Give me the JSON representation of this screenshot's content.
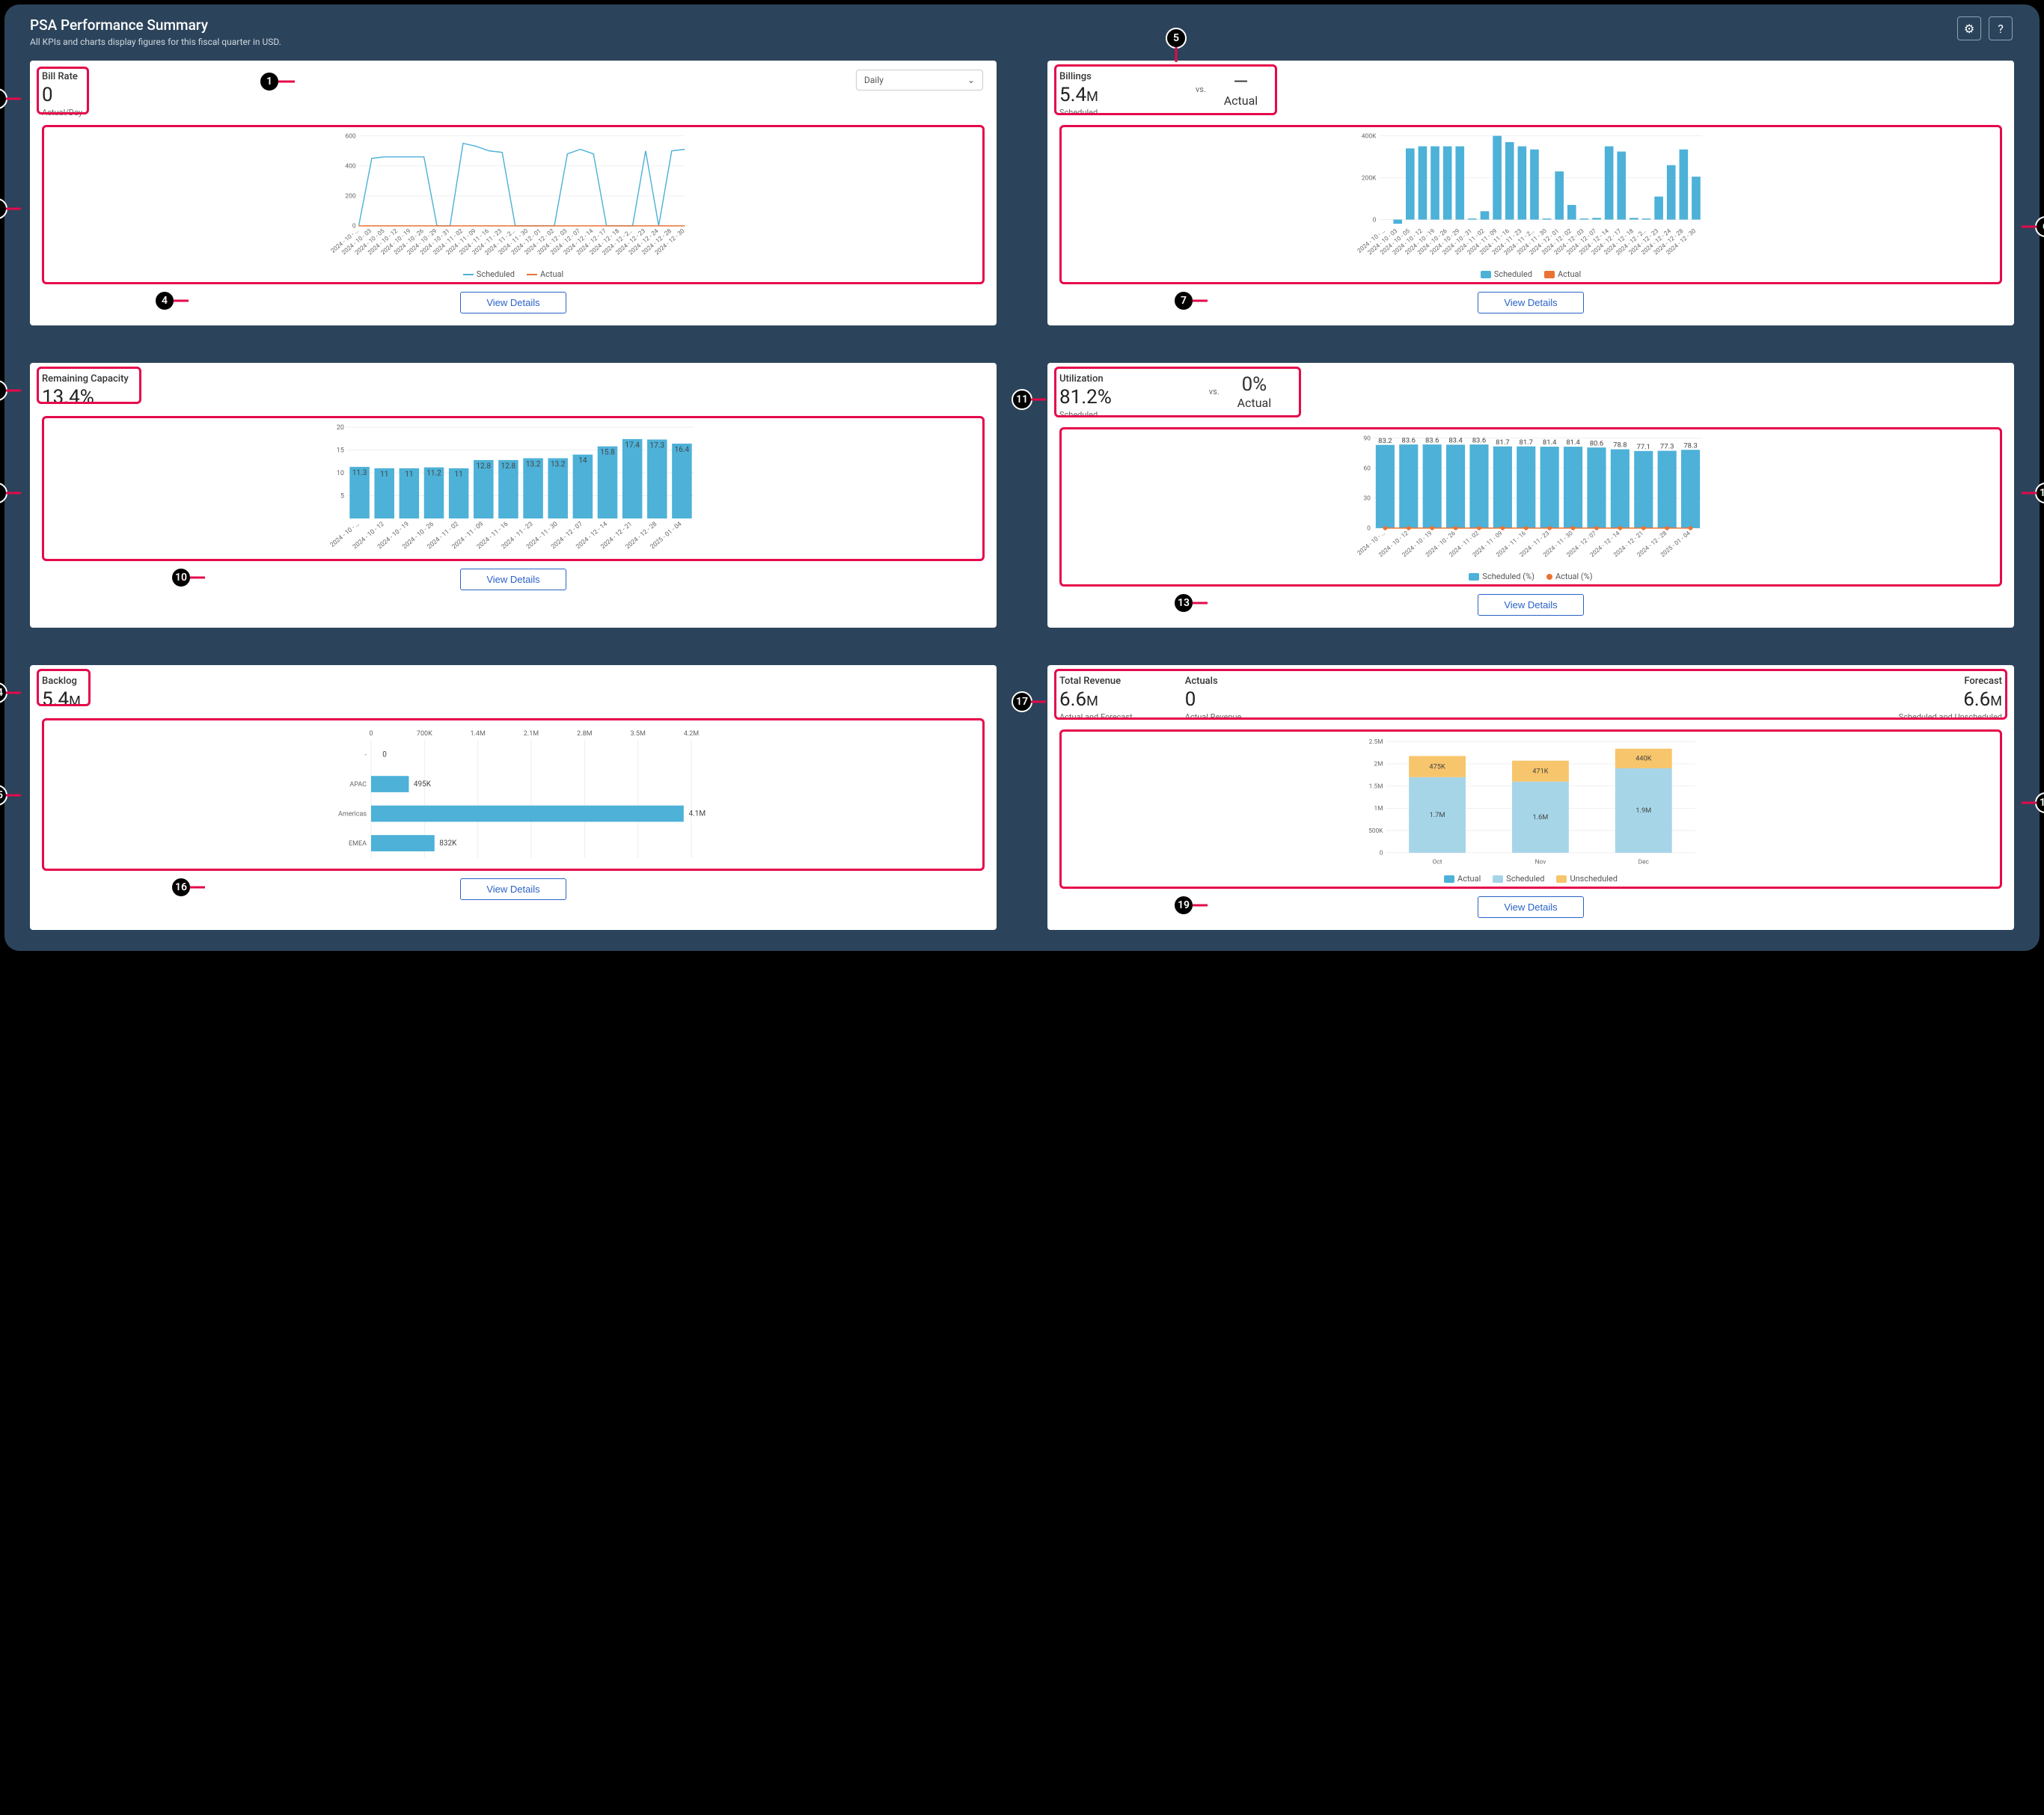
{
  "header": {
    "title": "PSA Performance Summary",
    "subtitle": "All KPIs and charts display figures for this fiscal quarter in USD."
  },
  "colors": {
    "scheduled": "#4db1d8",
    "actual": "#e97333",
    "unscheduled": "#f7c56b",
    "actualDot": "#e97333",
    "scheduledBar": "#4db1d8"
  },
  "viewDetailsLabel": "View Details",
  "cards": {
    "billRate": {
      "title": "Bill Rate",
      "value": "0",
      "sub": "Actual/Day",
      "selectLabel": "Daily",
      "legend": [
        "Scheduled",
        "Actual"
      ]
    },
    "billings": {
      "title": "Billings",
      "value": "5.4",
      "valueSuffix": "M",
      "sub": "Scheduled",
      "vsLabel": "vs.",
      "vsValue": "—",
      "vsSub": "Actual",
      "legend": [
        "Scheduled",
        "Actual"
      ]
    },
    "remaining": {
      "title": "Remaining Capacity",
      "value": "13.4%"
    },
    "utilization": {
      "title": "Utilization",
      "value": "81.2%",
      "sub": "Scheduled",
      "vsLabel": "vs.",
      "vsValue": "0%",
      "vsSub": "Actual",
      "legend": [
        "Scheduled (%)",
        "Actual (%)"
      ]
    },
    "backlog": {
      "title": "Backlog",
      "value": "5.4",
      "valueSuffix": "M"
    },
    "revenue": {
      "title": "Total Revenue",
      "value": "6.6",
      "valueSuffix": "M",
      "sub": "Actual and Forecast",
      "col2Title": "Actuals",
      "actualsValue": "0",
      "actualsSub": "Actual Revenue",
      "col3Title": "Forecast",
      "forecastValue": "6.6",
      "forecastSuffix": "M",
      "forecastSub": "Scheduled and Unscheduled",
      "legend": [
        "Actual",
        "Scheduled",
        "Unscheduled"
      ]
    }
  },
  "chart_data": [
    {
      "id": "bill_rate_chart",
      "type": "line",
      "categories": [
        "2024 - 10 - …",
        "2024 - 10 - 03",
        "2024 - 10 - 05",
        "2024 - 10 - 12",
        "2024 - 10 - 19",
        "2024 - 10 - 26",
        "2024 - 10 - 29",
        "2024 - 10 - 31",
        "2024 - 11 - 02",
        "2024 - 11 - 09",
        "2024 - 11 - 16",
        "2024 - 11 - 23",
        "2024 - 11 - 2…",
        "2024 - 11 - 30",
        "2024 - 12 - 01",
        "2024 - 12 - 02",
        "2024 - 12 - 03",
        "2024 - 12 - 07",
        "2024 - 12 - 14",
        "2024 - 12 - 17",
        "2024 - 12 - 18",
        "2024 - 12 - 2…",
        "2024 - 12 - 23",
        "2024 - 12 - 24",
        "2024 - 12 - 28",
        "2024 - 12 - 30"
      ],
      "series": [
        {
          "name": "Scheduled",
          "values": [
            0,
            450,
            460,
            460,
            460,
            460,
            0,
            0,
            550,
            530,
            500,
            490,
            0,
            0,
            0,
            0,
            480,
            510,
            480,
            0,
            0,
            0,
            500,
            0,
            500,
            510
          ]
        },
        {
          "name": "Actual",
          "values": [
            0,
            0,
            0,
            0,
            0,
            0,
            0,
            0,
            0,
            0,
            0,
            0,
            0,
            0,
            0,
            0,
            0,
            0,
            0,
            0,
            0,
            0,
            0,
            0,
            0,
            0
          ]
        }
      ],
      "ylim": [
        0,
        600
      ],
      "yticks": [
        0,
        200,
        400,
        600
      ],
      "xlabel": "",
      "ylabel": ""
    },
    {
      "id": "billings_chart",
      "type": "bar",
      "categories": [
        "2024 - 10 - …",
        "2024 - 10 - 03",
        "2024 - 10 - 05",
        "2024 - 10 - 12",
        "2024 - 10 - 19",
        "2024 - 10 - 26",
        "2024 - 10 - 29",
        "2024 - 10 - 31",
        "2024 - 11 - 02",
        "2024 - 11 - 09",
        "2024 - 11 - 16",
        "2024 - 11 - 23",
        "2024 - 11 - 2…",
        "2024 - 11 - 30",
        "2024 - 12 - 01",
        "2024 - 12 - 02",
        "2024 - 12 - 03",
        "2024 - 12 - 07",
        "2024 - 12 - 14",
        "2024 - 12 - 17",
        "2024 - 12 - 18",
        "2024 - 12 - 2…",
        "2024 - 12 - 23",
        "2024 - 12 - 24",
        "2024 - 12 - 28",
        "2024 - 12 - 30"
      ],
      "series": [
        {
          "name": "Scheduled",
          "values": [
            0,
            -20000,
            340000,
            350000,
            350000,
            350000,
            350000,
            5000,
            40000,
            400000,
            370000,
            350000,
            335000,
            5000,
            230000,
            70000,
            5000,
            8000,
            350000,
            325000,
            8000,
            5000,
            110000,
            260000,
            335000,
            205000
          ]
        },
        {
          "name": "Actual",
          "values": [
            0,
            0,
            0,
            0,
            0,
            0,
            0,
            0,
            0,
            0,
            0,
            0,
            0,
            0,
            0,
            0,
            0,
            0,
            0,
            0,
            0,
            0,
            0,
            0,
            0,
            0
          ]
        }
      ],
      "ylim": [
        -30000,
        400000
      ],
      "yticks": [
        0,
        200000,
        400000
      ],
      "ytick_labels": [
        "0",
        "200K",
        "400K"
      ],
      "xlabel": "",
      "ylabel": ""
    },
    {
      "id": "remaining_capacity_chart",
      "type": "bar",
      "categories": [
        "2024 - 10 - …",
        "2024 - 10 - 12",
        "2024 - 10 - 19",
        "2024 - 10 - 26",
        "2024 - 11 - 02",
        "2024 - 11 - 09",
        "2024 - 11 - 16",
        "2024 - 11 - 23",
        "2024 - 11 - 30",
        "2024 - 12 - 07",
        "2024 - 12 - 14",
        "2024 - 12 - 21",
        "2024 - 12 - 28",
        "2025 - 01 - 04"
      ],
      "values": [
        11.3,
        11,
        11,
        11.2,
        11,
        12.8,
        12.8,
        13.2,
        13.2,
        14,
        15.8,
        17.4,
        17.3,
        16.4
      ],
      "ylim": [
        0,
        20
      ],
      "yticks": [
        5,
        10,
        15,
        20
      ],
      "xlabel": "",
      "ylabel": ""
    },
    {
      "id": "utilization_chart",
      "type": "bar+line",
      "categories": [
        "2024 - 10 - …",
        "2024 - 10 - 12",
        "2024 - 10 - 19",
        "2024 - 10 - 26",
        "2024 - 11 - 02",
        "2024 - 11 - 09",
        "2024 - 11 - 16",
        "2024 - 11 - 23",
        "2024 - 11 - 30",
        "2024 - 12 - 07",
        "2024 - 12 - 14",
        "2024 - 12 - 21",
        "2024 - 12 - 28",
        "2025 - 01 - 04"
      ],
      "series": [
        {
          "name": "Scheduled (%)",
          "type": "bar",
          "values": [
            83.2,
            83.6,
            83.6,
            83.4,
            83.6,
            81.7,
            81.7,
            81.4,
            81.4,
            80.6,
            78.8,
            77.1,
            77.3,
            78.3
          ]
        },
        {
          "name": "Actual (%)",
          "type": "line",
          "values": [
            0,
            0,
            0,
            0,
            0,
            0,
            0,
            0,
            0,
            0,
            0,
            0,
            0,
            0
          ]
        }
      ],
      "ylim": [
        0,
        90
      ],
      "yticks": [
        0,
        30,
        60,
        90
      ],
      "xlabel": "",
      "ylabel": ""
    },
    {
      "id": "backlog_chart",
      "type": "bar-horizontal",
      "categories": [
        "-",
        "APAC",
        "Americas",
        "EMEA"
      ],
      "values": [
        0,
        495000,
        4100000,
        832000
      ],
      "value_labels": [
        "0",
        "495K",
        "4.1M",
        "832K"
      ],
      "xlim": [
        0,
        4200000
      ],
      "xticks": [
        0,
        700000,
        1400000,
        2100000,
        2800000,
        3500000,
        4200000
      ],
      "xtick_labels": [
        "0",
        "700K",
        "1.4M",
        "2.1M",
        "2.8M",
        "3.5M",
        "4.2M"
      ],
      "xlabel": "",
      "ylabel": ""
    },
    {
      "id": "revenue_chart",
      "type": "bar-stacked",
      "categories": [
        "Oct",
        "Nov",
        "Dec"
      ],
      "series": [
        {
          "name": "Actual",
          "values": [
            0,
            0,
            0
          ]
        },
        {
          "name": "Scheduled",
          "values": [
            1700000,
            1600000,
            1900000
          ],
          "labels": [
            "1.7M",
            "1.6M",
            "1.9M"
          ]
        },
        {
          "name": "Unscheduled",
          "values": [
            475000,
            471000,
            440000
          ],
          "labels": [
            "475K",
            "471K",
            "440K"
          ]
        }
      ],
      "ylim": [
        0,
        2500000
      ],
      "yticks": [
        0,
        500000,
        1000000,
        1500000,
        2000000,
        2500000
      ],
      "ytick_labels": [
        "0",
        "500K",
        "1M",
        "1.5M",
        "2M",
        "2.5M"
      ],
      "xlabel": "",
      "ylabel": ""
    }
  ]
}
